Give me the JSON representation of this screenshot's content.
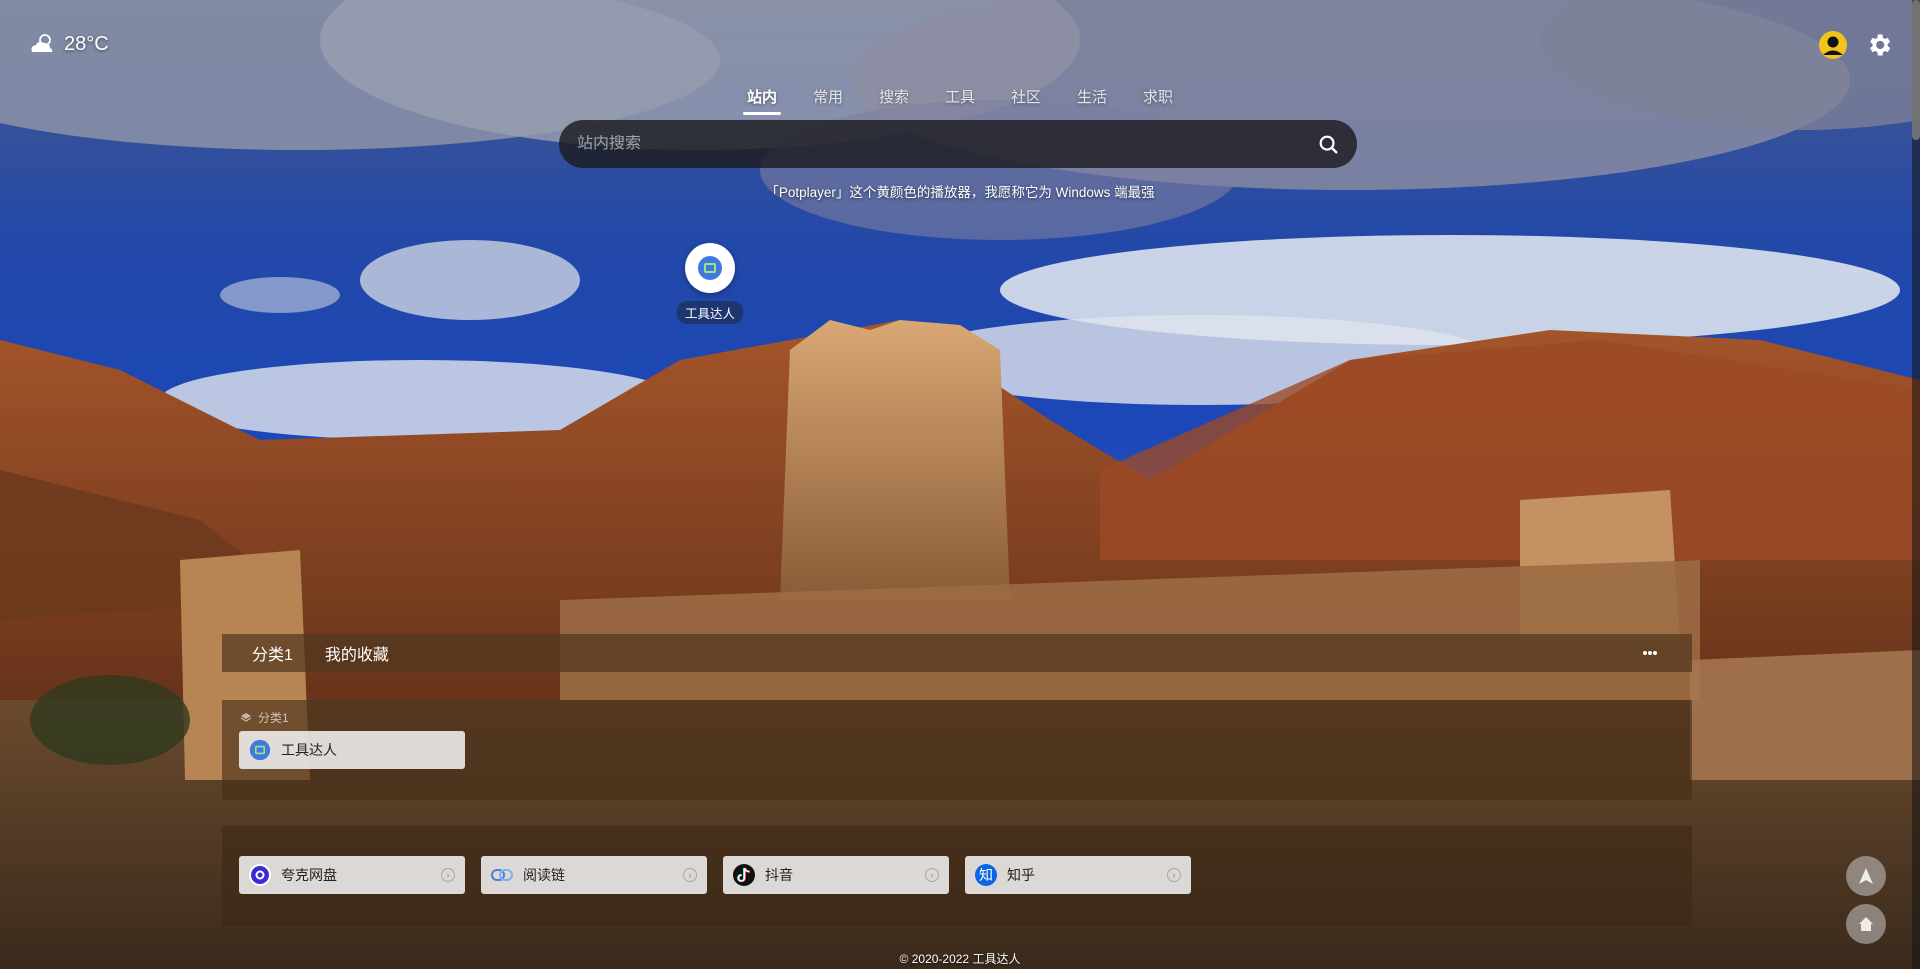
{
  "weather": {
    "icon": "partly-cloudy-icon",
    "temperature": "28°C"
  },
  "top_right": {
    "avatar_icon": "user-avatar-icon",
    "settings_icon": "gear-icon"
  },
  "search": {
    "tabs": [
      {
        "label": "站内",
        "active": true
      },
      {
        "label": "常用",
        "active": false
      },
      {
        "label": "搜索",
        "active": false
      },
      {
        "label": "工具",
        "active": false
      },
      {
        "label": "社区",
        "active": false
      },
      {
        "label": "生活",
        "active": false
      },
      {
        "label": "求职",
        "active": false
      }
    ],
    "placeholder": "站内搜索",
    "hint": "「Potplayer」这个黄颜色的播放器，我愿称它为 Windows 端最强"
  },
  "shortcut": {
    "label": "工具达人"
  },
  "favorites": {
    "tabs": [
      "分类1",
      "我的收藏"
    ],
    "group_title": "分类1",
    "group_links": [
      {
        "label": "工具达人"
      }
    ],
    "links": [
      {
        "label": "夸克网盘",
        "icon": "quark-icon"
      },
      {
        "label": "阅读链",
        "icon": "link-icon"
      },
      {
        "label": "抖音",
        "icon": "douyin-icon"
      },
      {
        "label": "知乎",
        "icon": "zhihu-icon",
        "icon_text": "知"
      }
    ]
  },
  "footer": "© 2020-2022  工具达人"
}
